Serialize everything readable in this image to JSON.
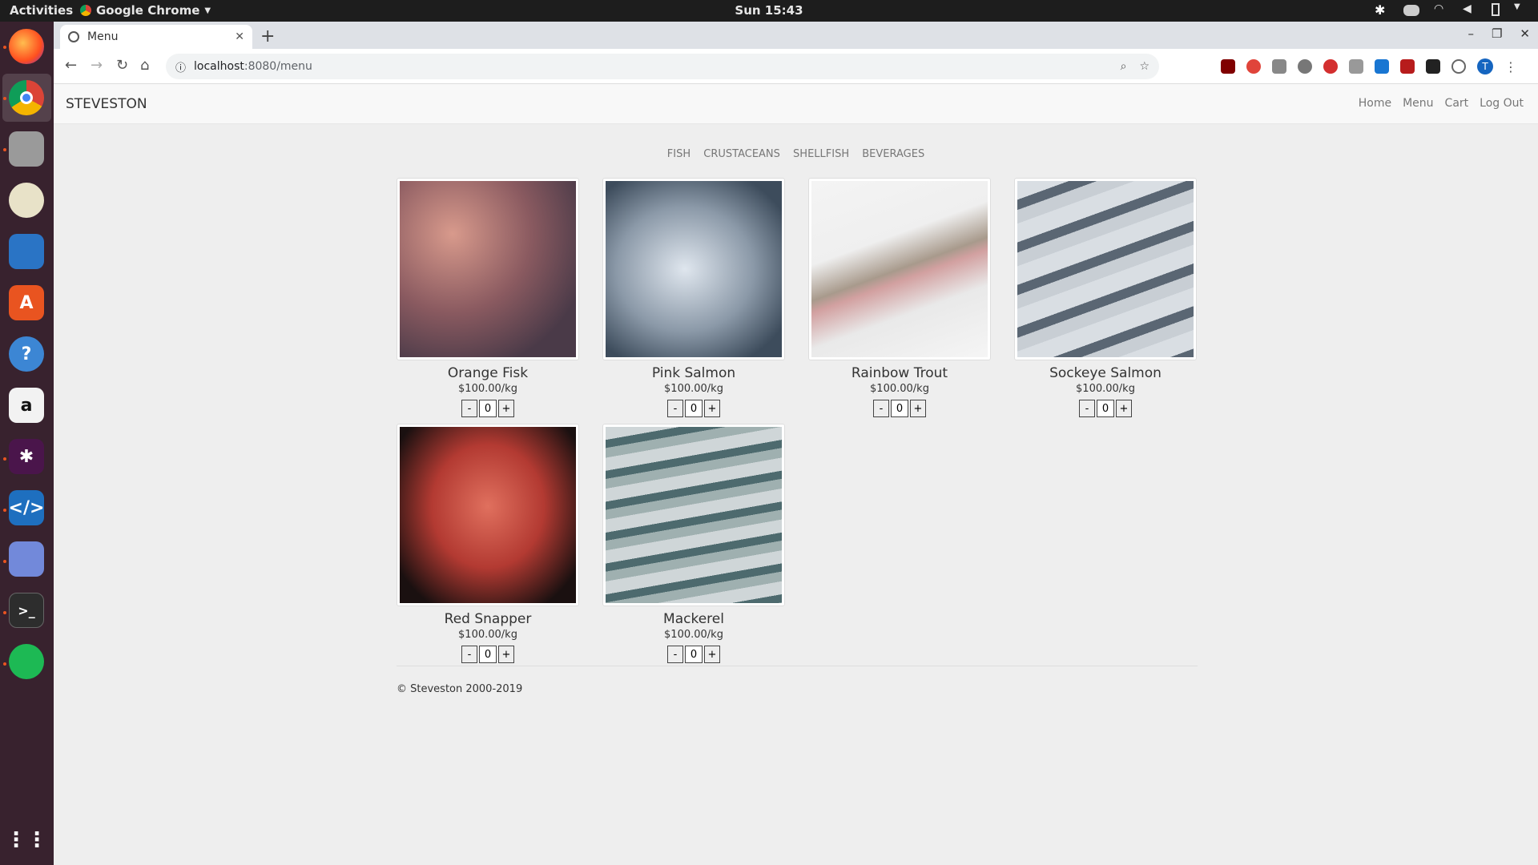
{
  "topbar": {
    "activities": "Activities",
    "app_menu": "Google Chrome",
    "clock": "Sun 15:43"
  },
  "browser": {
    "tab_title": "Menu",
    "url_host": "localhost",
    "url_path": ":8080/menu",
    "profile_initial": "T"
  },
  "site": {
    "brand": "STEVESTON",
    "nav": [
      "Home",
      "Menu",
      "Cart",
      "Log Out"
    ],
    "categories": [
      "FISH",
      "CRUSTACEANS",
      "SHELLFISH",
      "BEVERAGES"
    ],
    "footer": "© Steveston 2000-2019"
  },
  "products": [
    {
      "name": "Orange Fisk",
      "price": "$100.00/kg",
      "qty": "0"
    },
    {
      "name": "Pink Salmon",
      "price": "$100.00/kg",
      "qty": "0"
    },
    {
      "name": "Rainbow Trout",
      "price": "$100.00/kg",
      "qty": "0"
    },
    {
      "name": "Sockeye Salmon",
      "price": "$100.00/kg",
      "qty": "0"
    },
    {
      "name": "Red Snapper",
      "price": "$100.00/kg",
      "qty": "0"
    },
    {
      "name": "Mackerel",
      "price": "$100.00/kg",
      "qty": "0"
    }
  ],
  "qty_controls": {
    "minus": "-",
    "plus": "+"
  }
}
